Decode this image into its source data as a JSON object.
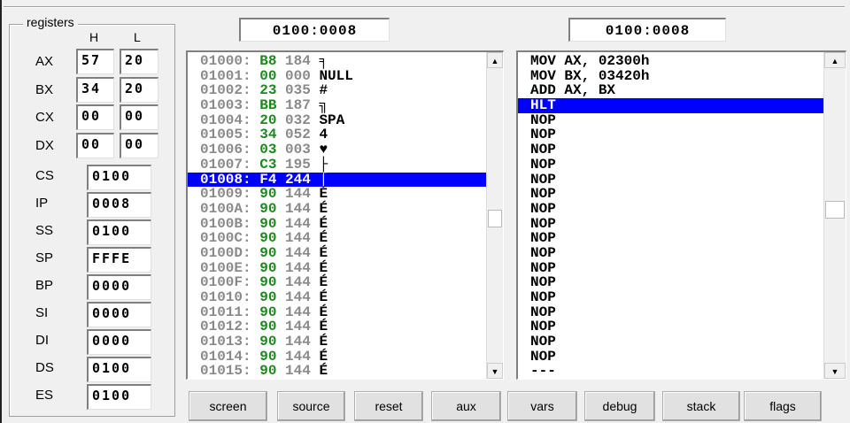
{
  "registers": {
    "title": "registers",
    "h_label": "H",
    "l_label": "L",
    "pairs": [
      {
        "name": "AX",
        "h": "57",
        "l": "20"
      },
      {
        "name": "BX",
        "h": "34",
        "l": "20"
      },
      {
        "name": "CX",
        "h": "00",
        "l": "00"
      },
      {
        "name": "DX",
        "h": "00",
        "l": "00"
      }
    ],
    "singles": [
      {
        "name": "CS",
        "value": "0100"
      },
      {
        "name": "IP",
        "value": "0008"
      },
      {
        "name": "SS",
        "value": "0100"
      },
      {
        "name": "SP",
        "value": "FFFE"
      },
      {
        "name": "BP",
        "value": "0000"
      },
      {
        "name": "SI",
        "value": "0000"
      },
      {
        "name": "DI",
        "value": "0000"
      },
      {
        "name": "DS",
        "value": "0100"
      },
      {
        "name": "ES",
        "value": "0100"
      }
    ]
  },
  "memory": {
    "address": "0100:0008",
    "selected_index": 8,
    "rows": [
      {
        "addr": "01000:",
        "hex": "B8",
        "dec": "184",
        "chr": "╕"
      },
      {
        "addr": "01001:",
        "hex": "00",
        "dec": "000",
        "chr": "NULL"
      },
      {
        "addr": "01002:",
        "hex": "23",
        "dec": "035",
        "chr": "#"
      },
      {
        "addr": "01003:",
        "hex": "BB",
        "dec": "187",
        "chr": "╗"
      },
      {
        "addr": "01004:",
        "hex": "20",
        "dec": "032",
        "chr": "SPA"
      },
      {
        "addr": "01005:",
        "hex": "34",
        "dec": "052",
        "chr": "4"
      },
      {
        "addr": "01006:",
        "hex": "03",
        "dec": "003",
        "chr": "♥"
      },
      {
        "addr": "01007:",
        "hex": "C3",
        "dec": "195",
        "chr": "├"
      },
      {
        "addr": "01008:",
        "hex": "F4",
        "dec": "244",
        "chr": "⌠"
      },
      {
        "addr": "01009:",
        "hex": "90",
        "dec": "144",
        "chr": "É"
      },
      {
        "addr": "0100A:",
        "hex": "90",
        "dec": "144",
        "chr": "É"
      },
      {
        "addr": "0100B:",
        "hex": "90",
        "dec": "144",
        "chr": "É"
      },
      {
        "addr": "0100C:",
        "hex": "90",
        "dec": "144",
        "chr": "É"
      },
      {
        "addr": "0100D:",
        "hex": "90",
        "dec": "144",
        "chr": "É"
      },
      {
        "addr": "0100E:",
        "hex": "90",
        "dec": "144",
        "chr": "É"
      },
      {
        "addr": "0100F:",
        "hex": "90",
        "dec": "144",
        "chr": "É"
      },
      {
        "addr": "01010:",
        "hex": "90",
        "dec": "144",
        "chr": "É"
      },
      {
        "addr": "01011:",
        "hex": "90",
        "dec": "144",
        "chr": "É"
      },
      {
        "addr": "01012:",
        "hex": "90",
        "dec": "144",
        "chr": "É"
      },
      {
        "addr": "01013:",
        "hex": "90",
        "dec": "144",
        "chr": "É"
      },
      {
        "addr": "01014:",
        "hex": "90",
        "dec": "144",
        "chr": "É"
      },
      {
        "addr": "01015:",
        "hex": "90",
        "dec": "144",
        "chr": "É"
      }
    ]
  },
  "disasm": {
    "address": "0100:0008",
    "selected_index": 3,
    "rows": [
      "MOV AX, 02300h",
      "MOV BX, 03420h",
      "ADD AX, BX",
      "HLT",
      "NOP",
      "NOP",
      "NOP",
      "NOP",
      "NOP",
      "NOP",
      "NOP",
      "NOP",
      "NOP",
      "NOP",
      "NOP",
      "NOP",
      "NOP",
      "NOP",
      "NOP",
      "NOP",
      "NOP",
      "---"
    ]
  },
  "buttons": [
    "screen",
    "source",
    "reset",
    "aux",
    "vars",
    "debug",
    "stack",
    "flags"
  ],
  "colors": {
    "selection": "#0000ff",
    "hex_green": "#1a8a1a",
    "addr_gray": "#8a8a8a"
  }
}
